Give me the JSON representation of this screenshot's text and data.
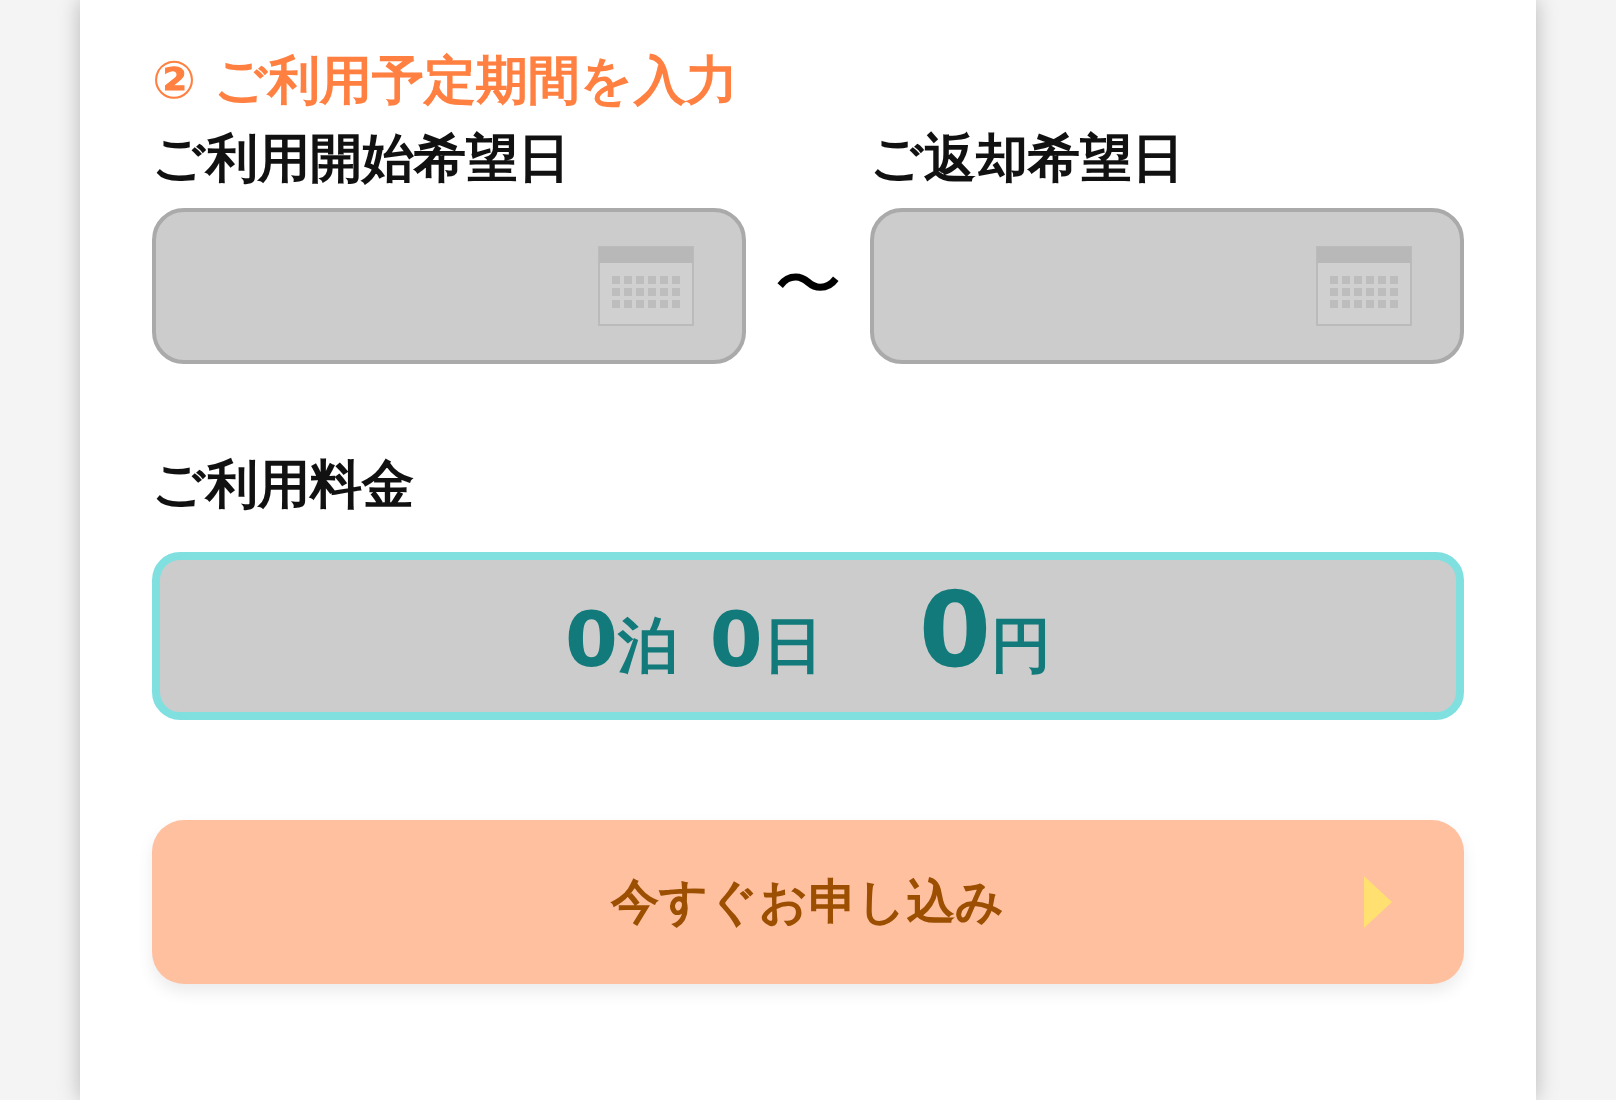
{
  "section_title": "② ご利用予定期間を入力",
  "date_fields": [
    {
      "label": "ご利用開始希望日"
    },
    {
      "label": "ご返却希望日"
    }
  ],
  "range_separator": "〜",
  "fee": {
    "label": "ご利用料金",
    "nights": "0",
    "nights_unit": "泊",
    "days": "0",
    "days_unit": "日",
    "price": "0",
    "price_unit": "円"
  },
  "submit_button": {
    "label": "今すぐお申し込み",
    "disabled": true
  }
}
